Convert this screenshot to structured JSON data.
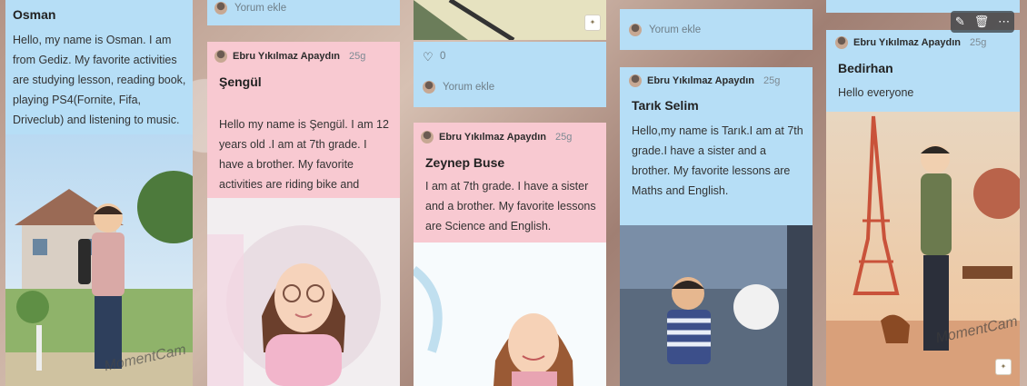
{
  "posts": [
    {
      "title": "Osman",
      "text": "Hello, my name is Osman. I am from Gediz. My favorite activities are studying lesson, reading book, playing PS4(Fornite, Fifa, Driveclub) and listening to music.",
      "watermark": "MomentCam"
    },
    {
      "prev_comment": "Yorum ekle",
      "author": "Ebru Yıkılmaz Apaydın",
      "time": "25g",
      "title": "Şengül",
      "text": "Hello my name is Şengül. I am 12 years old .I am at 7th grade. I have a brother. My favorite activities are riding bike and reading books."
    },
    {
      "likes": "0",
      "comment": "Yorum ekle",
      "author": "Ebru Yıkılmaz Apaydın",
      "time": "25g",
      "title": "Zeynep Buse",
      "text": "I am at 7th grade. I have a sister and a brother. My favorite lessons are Science and English."
    },
    {
      "prev_comment": "Yorum ekle",
      "author": "Ebru Yıkılmaz Apaydın",
      "time": "25g",
      "title": "Tarık Selim",
      "text": "Hello,my name is Tarık.I am at 7th grade.I have a sister and a brother. My favorite lessons are Maths and English."
    },
    {
      "author": "Ebru Yıkılmaz Apaydın",
      "time": "25g",
      "title": "Bedirhan",
      "text": "Hello everyone",
      "watermark": "MomentCam"
    }
  ],
  "toolbar": {
    "edit": "✎",
    "delete": "🗑",
    "more": "⋯"
  },
  "colors": {
    "blue_card": "#b6def6",
    "pink_card": "#f8c9d1",
    "background": "#b39486"
  }
}
